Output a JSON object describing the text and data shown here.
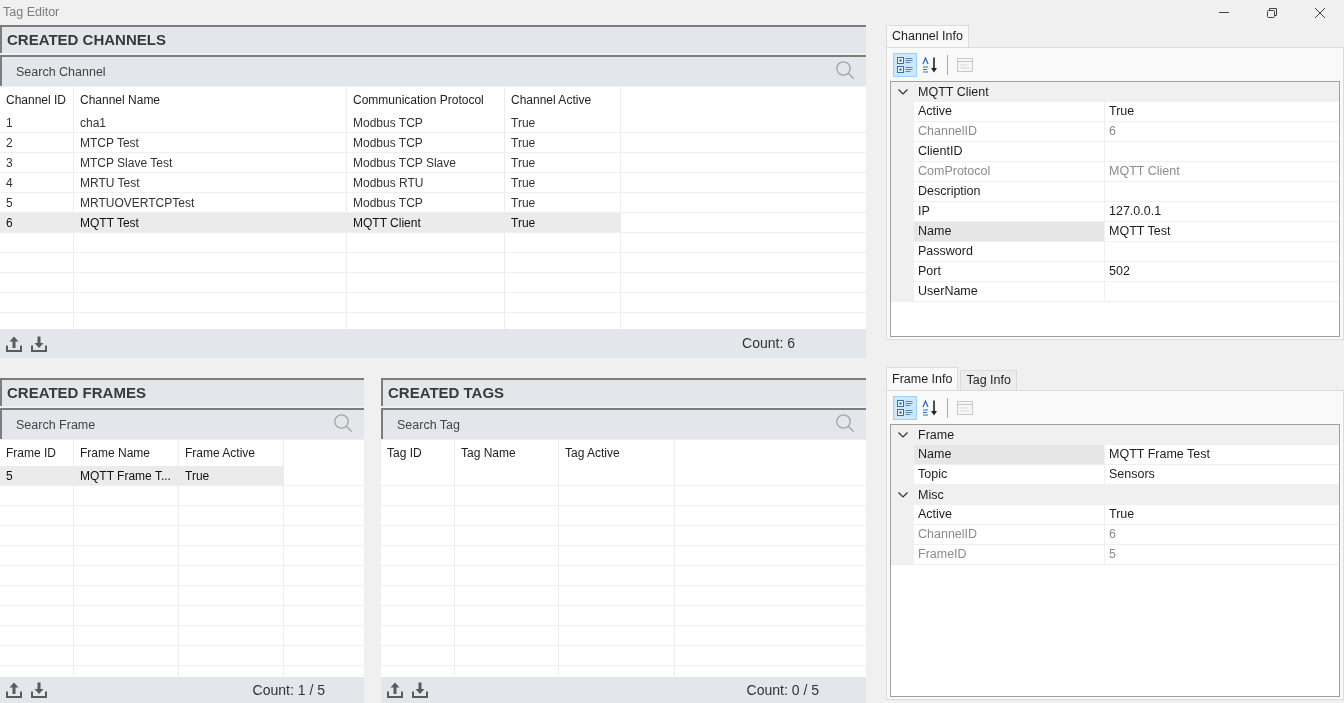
{
  "window": {
    "title": "Tag Editor"
  },
  "channels_panel": {
    "title": "CREATED CHANNELS",
    "search": {
      "placeholder": "Search Channel"
    },
    "table": {
      "columns": [
        "Channel ID",
        "Channel Name",
        "Communication Protocol",
        "Channel Active"
      ],
      "rows": [
        {
          "cells": [
            "1",
            "cha1",
            "Modbus TCP",
            "True"
          ],
          "selected": false
        },
        {
          "cells": [
            "2",
            "MTCP Test",
            "Modbus TCP",
            "True"
          ],
          "selected": false
        },
        {
          "cells": [
            "3",
            "MTCP Slave Test",
            "Modbus TCP Slave",
            "True"
          ],
          "selected": false
        },
        {
          "cells": [
            "4",
            "MRTU Test",
            "Modbus RTU",
            "True"
          ],
          "selected": false
        },
        {
          "cells": [
            "5",
            "MRTUOVERTCPTest",
            "Modbus TCP",
            "True"
          ],
          "selected": false
        },
        {
          "cells": [
            "6",
            "MQTT Test",
            "MQTT Client",
            "True"
          ],
          "selected": true
        }
      ]
    },
    "count": "Count: 6"
  },
  "frames_panel": {
    "title": "CREATED FRAMES",
    "search": {
      "placeholder": "Search Frame"
    },
    "table": {
      "columns": [
        "Frame ID",
        "Frame Name",
        "Frame Active"
      ],
      "rows": [
        {
          "cells": [
            "5",
            "MQTT Frame T...",
            "True"
          ],
          "selected": true
        }
      ]
    },
    "count": "Count: 1 / 5"
  },
  "tags_panel": {
    "title": "CREATED TAGS",
    "search": {
      "placeholder": "Search Tag"
    },
    "table": {
      "columns": [
        "Tag ID",
        "Tag Name",
        "Tag Active"
      ]
    },
    "count": "Count: 0 / 5"
  },
  "channel_info": {
    "tabs": [
      {
        "label": "Channel Info",
        "selected": true
      }
    ],
    "toolbar": [
      {
        "kind": "categorized",
        "selected": true,
        "disabled": false
      },
      {
        "kind": "alphabetical",
        "selected": false,
        "disabled": false
      },
      {
        "kind": "property_pages",
        "selected": false,
        "disabled": true
      }
    ],
    "categories": [
      {
        "name": "MQTT Client",
        "expanded": true,
        "properties": [
          {
            "name": "Active",
            "value": "True",
            "readonly": false,
            "selected": false
          },
          {
            "name": "ChannelID",
            "value": "6",
            "readonly": true,
            "selected": false
          },
          {
            "name": "ClientID",
            "readonly": false,
            "selected": false
          },
          {
            "name": "ComProtocol",
            "value": "MQTT Client",
            "readonly": true,
            "selected": false
          },
          {
            "name": "Description",
            "readonly": false,
            "selected": false
          },
          {
            "name": "IP",
            "value": "127.0.0.1",
            "readonly": false,
            "selected": false
          },
          {
            "name": "Name",
            "value": "MQTT Test",
            "readonly": false,
            "selected": true
          },
          {
            "name": "Password",
            "readonly": false,
            "selected": false
          },
          {
            "name": "Port",
            "value": "502",
            "readonly": false,
            "selected": false
          },
          {
            "name": "UserName",
            "readonly": false,
            "selected": false
          }
        ]
      }
    ]
  },
  "object_info": {
    "tabs": [
      {
        "label": "Frame Info",
        "selected": true
      },
      {
        "label": "Tag Info",
        "selected": false
      }
    ],
    "toolbar": [
      {
        "kind": "categorized",
        "selected": true,
        "disabled": false
      },
      {
        "kind": "alphabetical",
        "selected": false,
        "disabled": false
      },
      {
        "kind": "property_pages",
        "selected": false,
        "disabled": true
      }
    ],
    "categories": [
      {
        "name": "Frame",
        "expanded": true,
        "properties": [
          {
            "name": "Name",
            "value": "MQTT Frame Test",
            "readonly": false,
            "selected": true
          },
          {
            "name": "Topic",
            "value": "Sensors",
            "readonly": false,
            "selected": false
          }
        ]
      },
      {
        "name": "Misc",
        "expanded": true,
        "properties": [
          {
            "name": "Active",
            "value": "True",
            "readonly": false,
            "selected": false
          },
          {
            "name": "ChannelID",
            "value": "6",
            "readonly": true,
            "selected": false
          },
          {
            "name": "FrameID",
            "value": "5",
            "readonly": true,
            "selected": false
          }
        ]
      }
    ]
  }
}
